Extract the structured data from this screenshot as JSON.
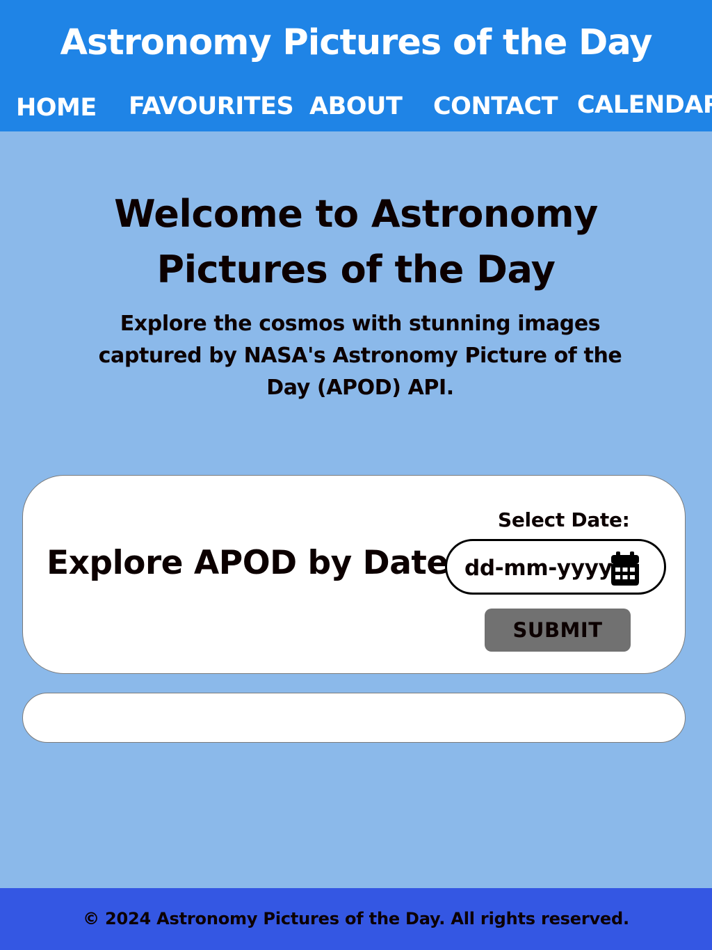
{
  "header": {
    "title": "Astronomy Pictures of the Day",
    "nav": {
      "home": "HOME",
      "favourites": "FAVOURITES",
      "about": "ABOUT",
      "contact": "CONTACT",
      "calendar": "CALENDAR"
    }
  },
  "hero": {
    "title": "Welcome to Astronomy Pictures of the Day",
    "subtitle": "Explore the cosmos with stunning images captured by NASA's Astronomy Picture of the Day (APOD) API."
  },
  "explore": {
    "title": "Explore APOD by Date",
    "date_label": "Select Date:",
    "date_placeholder": "dd-mm-yyyy",
    "date_icon": "calendar-icon",
    "submit_label": "SUBMIT"
  },
  "footer": {
    "text": "© 2024 Astronomy Pictures of the Day. All rights reserved."
  },
  "colors": {
    "header_bg": "#1f84e6",
    "page_bg": "#8bb9ea",
    "footer_bg": "#3457e3",
    "button_bg": "#717171",
    "card_bg": "#ffffff"
  }
}
